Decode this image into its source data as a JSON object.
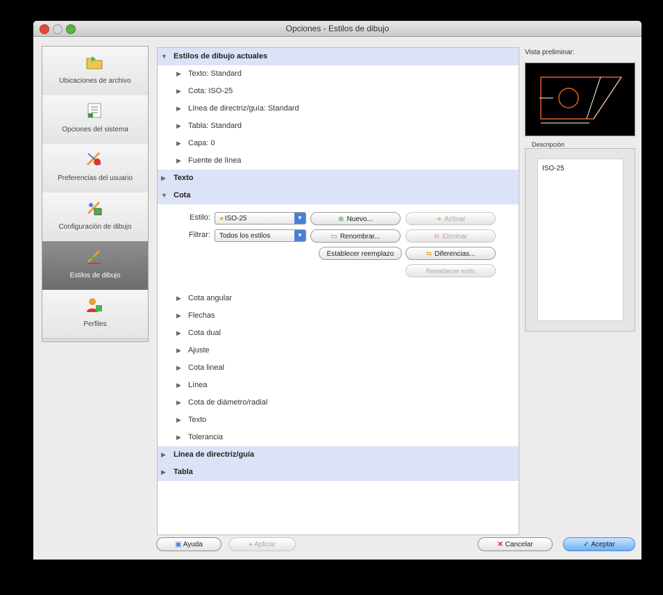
{
  "window": {
    "title": "Opciones - Estilos de dibujo"
  },
  "sidebar": {
    "items": [
      {
        "label": "Ubicaciones de archivo",
        "icon": "folder-icon"
      },
      {
        "label": "Opciones del sistema",
        "icon": "system-options-icon"
      },
      {
        "label": "Preferencias del usuario",
        "icon": "user-preferences-icon"
      },
      {
        "label": "Configuración de dibujo",
        "icon": "drawing-setup-icon"
      },
      {
        "label": "Estilos de dibujo",
        "icon": "drawing-styles-icon",
        "active": true
      },
      {
        "label": "Perfiles",
        "icon": "profiles-icon"
      }
    ]
  },
  "tree": {
    "sections": [
      {
        "label": "Estilos de dibujo actuales",
        "expanded": true
      },
      {
        "label": "Texto",
        "expanded": false
      },
      {
        "label": "Cota",
        "expanded": true
      },
      {
        "label": "Línea de directriz/guía",
        "expanded": false
      },
      {
        "label": "Tabla",
        "expanded": false
      }
    ],
    "current_items": [
      "Texto: Standard",
      "Cota: ISO-25",
      "Línea de directriz/guía: Standard",
      "Tabla: Standard",
      "Capa: 0",
      "Fuente de línea"
    ],
    "cota_items": [
      "Cota angular",
      "Flechas",
      "Cota dual",
      "Ajuste",
      "Cota lineal",
      "Línea",
      "Cota de diámetro/radial",
      "Texto",
      "Tolerancia"
    ]
  },
  "cota_form": {
    "estilo_label": "Estilo:",
    "estilo_value": "ISO-25",
    "filtrar_label": "Filtrar:",
    "filtrar_value": "Todos los estilos",
    "nuevo": "Nuevo...",
    "activar": "Activar",
    "renombrar": "Renombrar...",
    "eliminar": "Eliminar",
    "establecer": "Establecer reemplazo",
    "diferencias": "Diferencias...",
    "restablecer": "Restablecer estilo"
  },
  "preview": {
    "label": "Vista preliminar:"
  },
  "description": {
    "label": "Descripción",
    "value": "ISO-25"
  },
  "buttons": {
    "ayuda": "Ayuda",
    "aplicar": "Aplicar",
    "cancelar": "Cancelar",
    "aceptar": "Aceptar"
  },
  "colors": {
    "section_bg": "#dde3f7",
    "active_sidebar": "#7d7d7d",
    "accent": "#4a7fd6"
  }
}
